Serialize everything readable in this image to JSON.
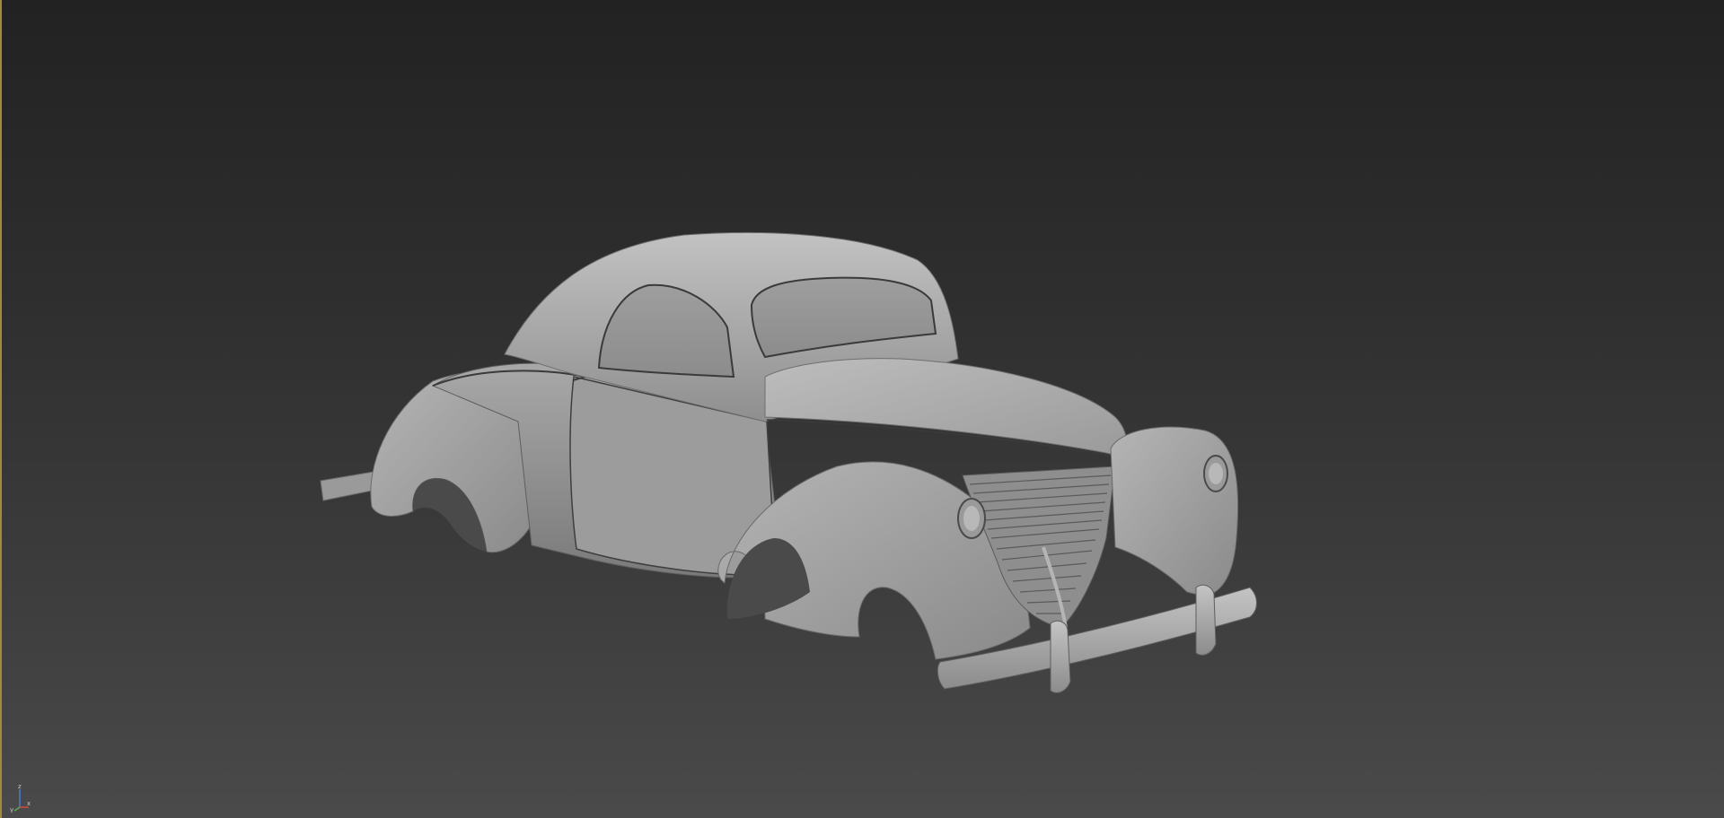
{
  "viewport": {
    "background_top": "#222222",
    "background_bottom": "#4a4a4a",
    "active_border_color": "#a08a3c",
    "shading_mode": "default shading"
  },
  "model": {
    "subject": "coupe-car-body",
    "material_color": "#a9a9a9"
  },
  "axis_gizmo": {
    "z_label": "z",
    "x_label": "x",
    "y_label": "y",
    "x_color": "#d04a3a",
    "y_color": "#5ab04a",
    "z_color": "#4a7ad0"
  }
}
